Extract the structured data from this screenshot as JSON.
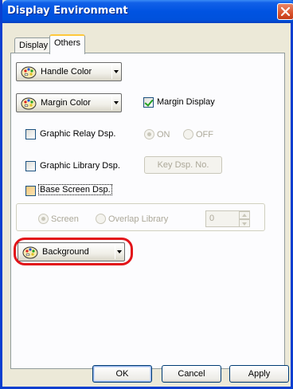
{
  "window": {
    "title": "Display Environment"
  },
  "tabs": [
    {
      "label": "Display",
      "active": false
    },
    {
      "label": "Others",
      "active": true
    }
  ],
  "controls": {
    "handle_color": {
      "label": "Handle Color",
      "icon": "palette-icon"
    },
    "margin_color": {
      "label": "Margin Color",
      "icon": "palette-icon"
    },
    "margin_display": {
      "label": "Margin Display",
      "checked": true
    },
    "graphic_relay": {
      "label": "Graphic Relay Dsp.",
      "checked": false
    },
    "relay_on": {
      "label": "ON",
      "selected": true
    },
    "relay_off": {
      "label": "OFF",
      "selected": false
    },
    "graphic_library": {
      "label": "Graphic Library Dsp.",
      "checked": false
    },
    "key_dsp_button": {
      "label": "Key Dsp. No."
    },
    "base_screen": {
      "label": "Base Screen Dsp.",
      "checked": false
    },
    "screen_radio": {
      "label": "Screen",
      "selected": true
    },
    "overlap_radio": {
      "label": "Overlap Library",
      "selected": false
    },
    "overlap_number": {
      "value": "0"
    },
    "background": {
      "label": "Background",
      "icon": "palette-icon"
    }
  },
  "footer": {
    "ok": "OK",
    "cancel": "Cancel",
    "apply": "Apply"
  },
  "colors": {
    "title_bar": "#0053e1",
    "highlight": "#e2141a"
  }
}
